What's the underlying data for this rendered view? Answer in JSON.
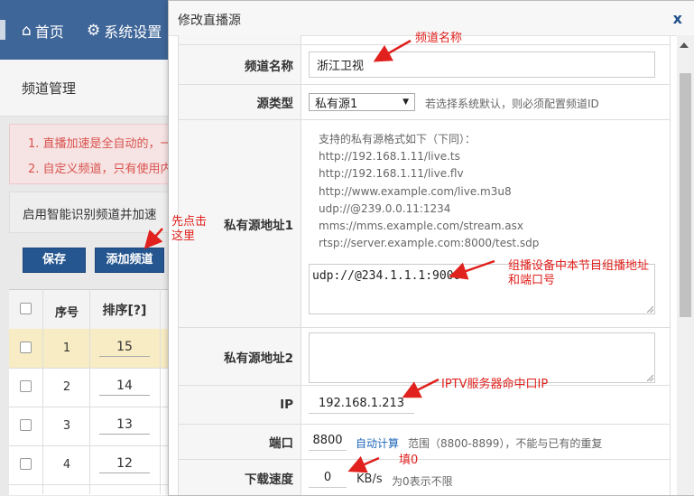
{
  "topnav": {
    "home_label": "首页",
    "settings_label": "系统设置"
  },
  "background": {
    "page_title": "频道管理",
    "notice_lines": [
      "1. 直播加速是全自动的，一",
      "2. 自定义频道，只有使用内"
    ],
    "smart_bar_text": "启用智能识别频道并加速",
    "save_button": "保存",
    "add_channel_button": "添加频道",
    "table": {
      "headers": [
        "序号",
        "排序[?]"
      ],
      "rows": [
        {
          "index": "1",
          "sort": "15"
        },
        {
          "index": "2",
          "sort": "14"
        },
        {
          "index": "3",
          "sort": "13"
        },
        {
          "index": "4",
          "sort": "12"
        }
      ]
    }
  },
  "modal": {
    "title": "修改直播源",
    "close_label": "x",
    "fields": {
      "channel_name": {
        "label": "频道名称",
        "value": "浙江卫视"
      },
      "source_type": {
        "label": "源类型",
        "value": "私有源1",
        "hint": "若选择系统默认，则必须配置频道ID"
      },
      "private_source_1": {
        "label": "私有源地址1",
        "formats_title": "支持的私有源格式如下（下同）：",
        "formats": [
          "http://192.168.1.11/live.ts",
          "http://192.168.1.11/live.flv",
          "http://www.example.com/live.m3u8",
          "udp://@239.0.0.11:1234",
          "mms://mms.example.com/stream.asx",
          "rtsp://server.example.com:8000/test.sdp"
        ],
        "value": "udp://@234.1.1.1:9000"
      },
      "private_source_2": {
        "label": "私有源地址2",
        "value": ""
      },
      "ip": {
        "label": "IP",
        "value": "192.168.1.213"
      },
      "port": {
        "label": "端口",
        "value": "8800",
        "auto_link": "自动计算",
        "hint": "范围（8800-8899），不能与已有的重复"
      },
      "download_speed": {
        "label": "下载速度",
        "value": "0",
        "unit": "KB/s",
        "hint": "为0表示不限"
      }
    }
  },
  "annotations": {
    "channel_name": "频道名称",
    "click_first": [
      "先点击",
      "这里"
    ],
    "multicast": [
      "组播设备中本节目组播地址",
      "和端口号"
    ],
    "iptv_ip": "IPTV服务器命中口IP",
    "fill_zero": "填0"
  },
  "colors": {
    "topbar": "#3f6698",
    "button_blue": "#26568f",
    "annotation_red": "#e0211d",
    "link_blue": "#1f66b8",
    "highlight_row": "#f7ecc3"
  }
}
